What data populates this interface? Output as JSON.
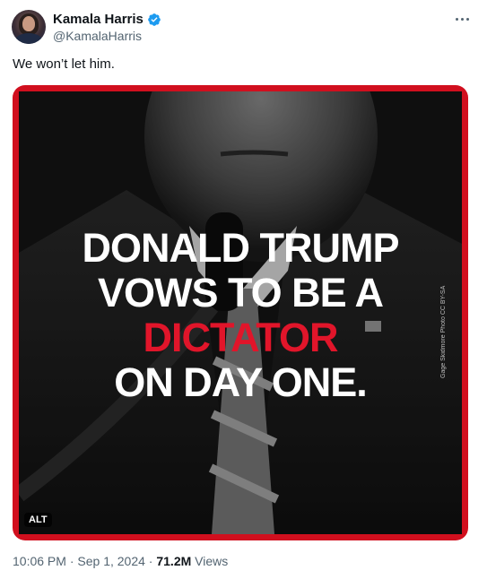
{
  "author": {
    "display_name": "Kamala Harris",
    "handle": "@KamalaHarris",
    "verified": true
  },
  "tweet": {
    "text": "We won’t let him."
  },
  "media": {
    "headline_line1": "DONALD TRUMP",
    "headline_line2": "VOWS TO BE A",
    "headline_line3": "DICTATOR",
    "headline_line4": "ON DAY ONE.",
    "photo_credit": "Gage Skidmore Photo CC BY-SA",
    "alt_badge": "ALT",
    "border_color": "#d10f1e",
    "accent_color": "#e1152a"
  },
  "meta": {
    "time": "10:06 PM",
    "separator1": " · ",
    "date": "Sep 1, 2024",
    "separator2": " · ",
    "views_count": "71.2M",
    "views_label": " Views"
  },
  "icons": {
    "verified": "verified-badge-icon",
    "more": "more-options-icon"
  },
  "colors": {
    "text_primary": "#0f1419",
    "text_secondary": "#536471",
    "verified_blue": "#1d9bf0"
  }
}
